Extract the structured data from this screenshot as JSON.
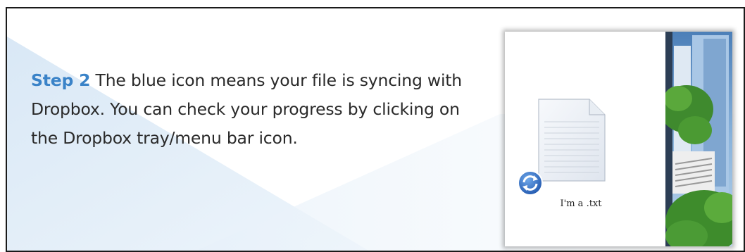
{
  "step": {
    "label": "Step 2",
    "text": "The blue icon means your file is syncing with Dropbox.  You can check your progress by clicking on the Dropbox tray/menu bar icon."
  },
  "screenshot": {
    "file_name": "I'm a .txt",
    "file_icon": "text-document-icon",
    "badge_icon": "sync-icon"
  },
  "colors": {
    "step_label": "#3a83c8",
    "body_text": "#2a2a2a",
    "sync_badge": "#2f6fc9"
  }
}
